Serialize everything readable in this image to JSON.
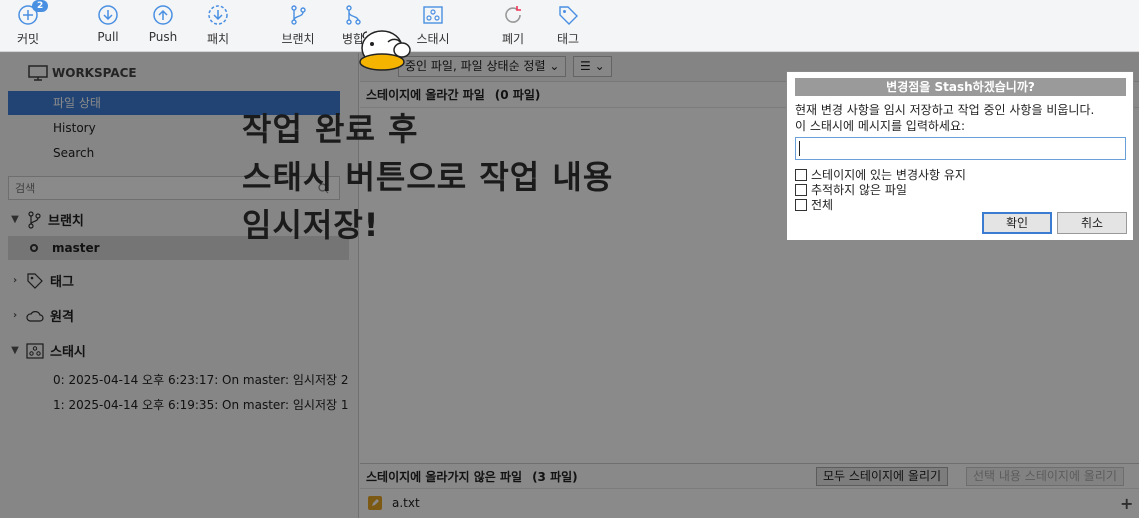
{
  "toolbar": {
    "commit": {
      "label": "커밋",
      "badge": "2"
    },
    "pull": {
      "label": "Pull"
    },
    "push": {
      "label": "Push"
    },
    "fetch": {
      "label": "패치"
    },
    "branch": {
      "label": "브랜치"
    },
    "merge": {
      "label": "병합"
    },
    "stash": {
      "label": "스태시"
    },
    "discard": {
      "label": "폐기"
    },
    "tag": {
      "label": "태그"
    }
  },
  "sidebar": {
    "workspace_label": "WORKSPACE",
    "nav": [
      "파일 상태",
      "History",
      "Search"
    ],
    "search_placeholder": "검색",
    "branches_label": "브랜치",
    "current_branch": "master",
    "tags_label": "태그",
    "remotes_label": "원격",
    "stashes_label": "스태시",
    "stashes": [
      "0: 2025-04-14 오후 6:23:17: On master: 임시저장 2",
      "1: 2025-04-14 오후 6:19:35: On master: 임시저장 1"
    ]
  },
  "main": {
    "filter_select": "중인 파일, 파일 상태순 정렬",
    "staged_header": "스테이지에 올라간 파일",
    "staged_count": "(0 파일)",
    "unstaged_header": "스테이지에 올라가지 않은 파일",
    "unstaged_count": "(3 파일)",
    "stage_all_label": "모두 스테이지에 올리기",
    "stage_selected_label": "선택 내용 스테이지에 올리기",
    "files": [
      "a.txt"
    ]
  },
  "annotation": {
    "line1": "작업 완료 후",
    "line2": "스태시 버튼으로 작업 내용",
    "line3": "임시저장!"
  },
  "dialog": {
    "title": "변경점을 Stash하겠습니까?",
    "message_line1": "현재 변경 사항을 임시 저장하고 작업 중인 사항을 비웁니다.",
    "message_line2": "이 스태시에 메시지를 입력하세요:",
    "input_value": "",
    "options": [
      "스테이지에 있는 변경사항 유지",
      "추적하지 않은 파일",
      "전체"
    ],
    "ok_label": "확인",
    "cancel_label": "취소"
  },
  "colors": {
    "accent": "#3d7fd6",
    "toolbar_icon": "#4a90e2",
    "dialog_title_bg": "#9a9a9a"
  }
}
